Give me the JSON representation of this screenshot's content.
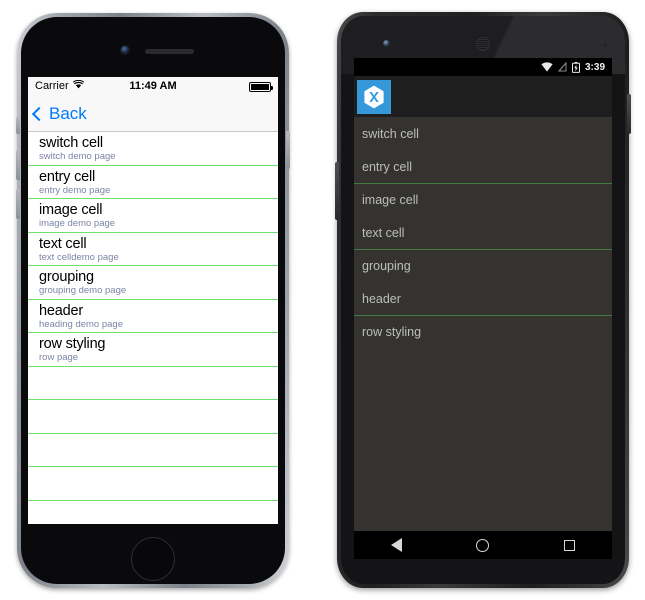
{
  "ios": {
    "status_bar": {
      "carrier": "Carrier",
      "wifi_icon": "wifi-icon",
      "time": "11:49 AM",
      "battery_icon": "battery-full-icon"
    },
    "nav_bar": {
      "back_label": "Back",
      "back_icon": "chevron-left-icon"
    },
    "rows": [
      {
        "title": "switch cell",
        "detail": "switch demo page"
      },
      {
        "title": "entry cell",
        "detail": "entry demo page"
      },
      {
        "title": "image cell",
        "detail": "image demo page"
      },
      {
        "title": "text cell",
        "detail": "text celldemo page"
      },
      {
        "title": "grouping",
        "detail": "grouping demo page"
      },
      {
        "title": "header",
        "detail": "heading demo page"
      },
      {
        "title": "row styling",
        "detail": "row page"
      }
    ],
    "empty_row_count": 5,
    "colors": {
      "separator": "#6fe06f",
      "accent": "#007aff",
      "detail_text": "#7d84a5",
      "bar_background": "#f8f8f8"
    }
  },
  "android": {
    "status_bar": {
      "wifi_icon": "wifi-icon",
      "signal_icon": "signal-off-icon",
      "battery_icon": "battery-charging-icon",
      "time": "3:39"
    },
    "action_bar": {
      "app_icon": "xamarin-logo-icon"
    },
    "rows": [
      {
        "label": "switch cell",
        "separator_above": false
      },
      {
        "label": "entry cell",
        "separator_above": false
      },
      {
        "label": "image cell",
        "separator_above": true
      },
      {
        "label": "text cell",
        "separator_above": false
      },
      {
        "label": "grouping",
        "separator_above": true
      },
      {
        "label": "header",
        "separator_above": false
      },
      {
        "label": "row styling",
        "separator_above": true
      }
    ],
    "nav_bar": {
      "back_icon": "triangle-back-icon",
      "home_icon": "circle-home-icon",
      "recents_icon": "square-recents-icon"
    },
    "colors": {
      "list_background": "#343330",
      "action_bar": "#1e1e1e",
      "separator": "#3f7a3f",
      "app_icon_background": "#3498db",
      "row_text": "#bdbdbd"
    }
  }
}
